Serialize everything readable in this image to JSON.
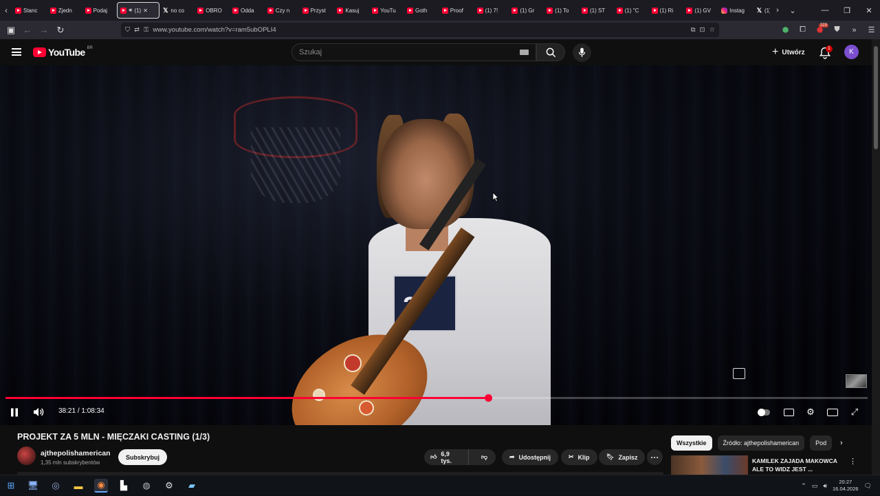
{
  "browser": {
    "tabs": [
      {
        "label": "Stanc",
        "icon": "youtube-icon"
      },
      {
        "label": "Zjedn",
        "icon": "youtube-icon"
      },
      {
        "label": "Podaj",
        "icon": "youtube-icon"
      },
      {
        "label": "(1)",
        "icon": "youtube-icon",
        "active": true
      },
      {
        "label": "no co",
        "icon": "x-icon"
      },
      {
        "label": "OBRO",
        "icon": "youtube-icon"
      },
      {
        "label": "Odda",
        "icon": "youtube-icon"
      },
      {
        "label": "Czy n",
        "icon": "youtube-icon"
      },
      {
        "label": "Przyst",
        "icon": "youtube-icon"
      },
      {
        "label": "Kasuj",
        "icon": "youtube-icon"
      },
      {
        "label": "YouTu",
        "icon": "youtube-icon"
      },
      {
        "label": "Goth",
        "icon": "youtube-icon"
      },
      {
        "label": "Proof",
        "icon": "youtube-icon"
      },
      {
        "label": "(1) 7!",
        "icon": "youtube-icon"
      },
      {
        "label": "(1) Gr",
        "icon": "youtube-icon"
      },
      {
        "label": "(1) To",
        "icon": "youtube-icon"
      },
      {
        "label": "(1) ST",
        "icon": "youtube-icon"
      },
      {
        "label": "(1) \"C",
        "icon": "youtube-icon"
      },
      {
        "label": "(1) Ri",
        "icon": "youtube-icon"
      },
      {
        "label": "(1) GV",
        "icon": "youtube-icon"
      },
      {
        "label": "Instag",
        "icon": "instagram-icon"
      },
      {
        "label": "(1)",
        "icon": "x-icon"
      }
    ],
    "url": "www.youtube.com/watch?v=ram5ubOPLI4",
    "extension_badge": "223"
  },
  "youtube": {
    "logo_text": "YouTube",
    "region": "BR",
    "search_placeholder": "Szukaj",
    "create_label": "Utwórz",
    "notification_count": "1",
    "avatar_letter": "K"
  },
  "player": {
    "time_current": "38:21",
    "time_total": "1:08:34",
    "time_separator": "/",
    "progress": 0.56,
    "bib_number": "2"
  },
  "video": {
    "title": "PROJEKT ZA 5 MLN - MIĘCZAKI CASTING (1/3)",
    "channel_name": "ajthepolishamerican",
    "channel_subs": "1,35 mln subskrybentów",
    "subscribe_label": "Subskrybuj",
    "likes": "6,9 tys.",
    "share_label": "Udostępnij",
    "clip_label": "Klip",
    "save_label": "Zapisz"
  },
  "sidebar": {
    "chips": [
      "Wszystkie",
      "Źródło: ajthepolishamerican",
      "Pod"
    ],
    "recommendation_title": "KAMILEK ZAJADA MAKOWCA ALE TO WIDZ JEST ..."
  },
  "taskbar": {
    "time": "20:27",
    "date": "16.04.2026"
  },
  "colors": {
    "accent": "#ff0033",
    "background": "#0f0f0f",
    "pill": "#272727"
  }
}
